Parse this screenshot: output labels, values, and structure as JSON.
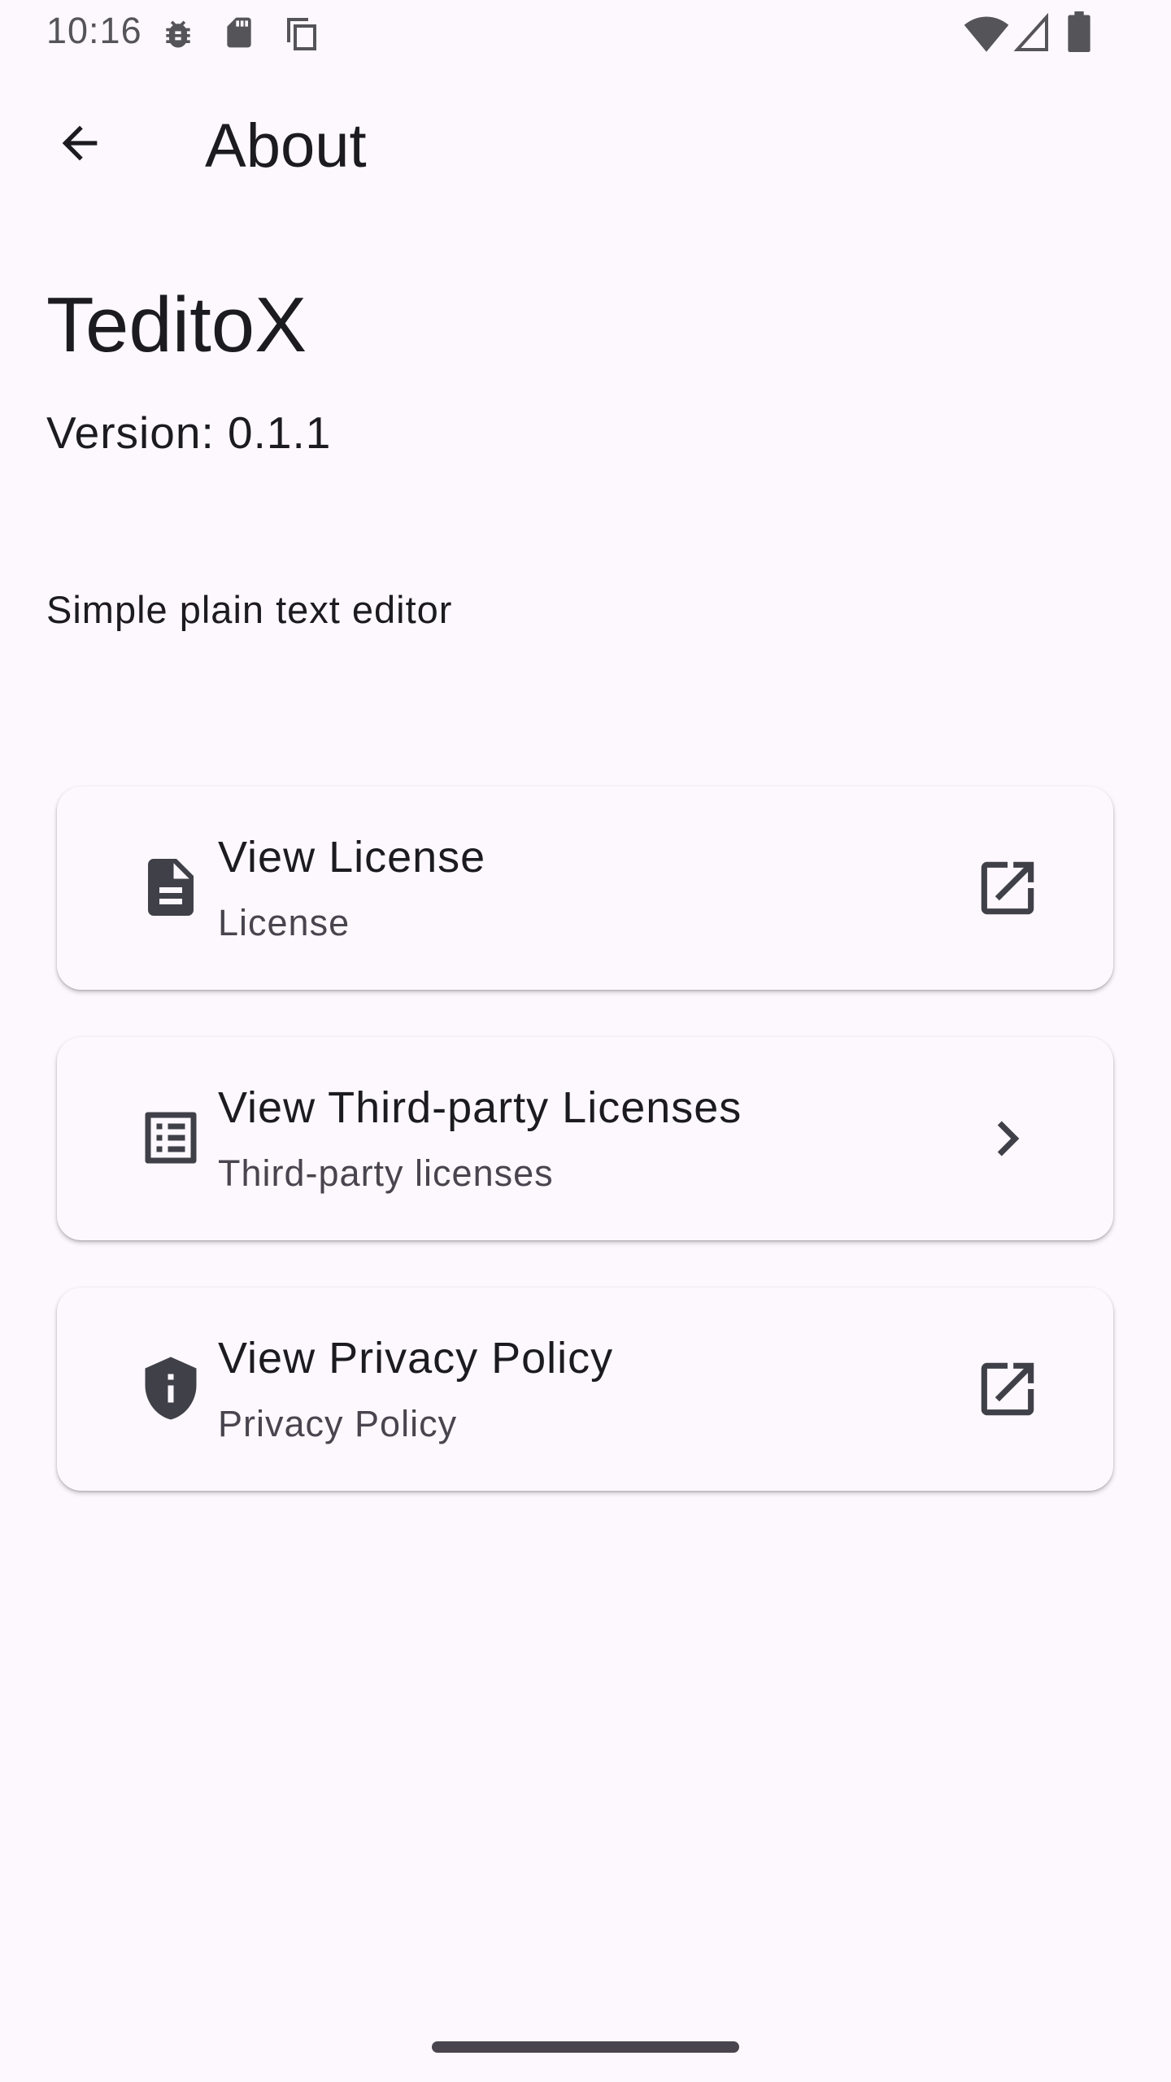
{
  "status_bar": {
    "time": "10:16",
    "left_icons": [
      "bug-icon",
      "sd-card-icon",
      "copy-icon"
    ],
    "right_icons": [
      "wifi-icon",
      "signal-icon",
      "battery-icon"
    ]
  },
  "app_bar": {
    "back_icon": "arrow-back-icon",
    "title": "About"
  },
  "app": {
    "name": "TeditoX",
    "version": "Version: 0.1.1",
    "description": "Simple plain text editor"
  },
  "cards": [
    {
      "icon": "description-icon",
      "title": "View License",
      "subtitle": "License",
      "trailing_icon": "open-in-new-icon"
    },
    {
      "icon": "list-alt-icon",
      "title": "View Third-party Licenses",
      "subtitle": "Third-party licenses",
      "trailing_icon": "chevron-right-icon"
    },
    {
      "icon": "privacy-shield-icon",
      "title": "View Privacy Policy",
      "subtitle": "Privacy Policy",
      "trailing_icon": "open-in-new-icon"
    }
  ],
  "colors": {
    "background": "#fdf8fd",
    "text_primary": "#1c1b1f",
    "text_secondary": "#49454f",
    "icon": "#404049"
  }
}
